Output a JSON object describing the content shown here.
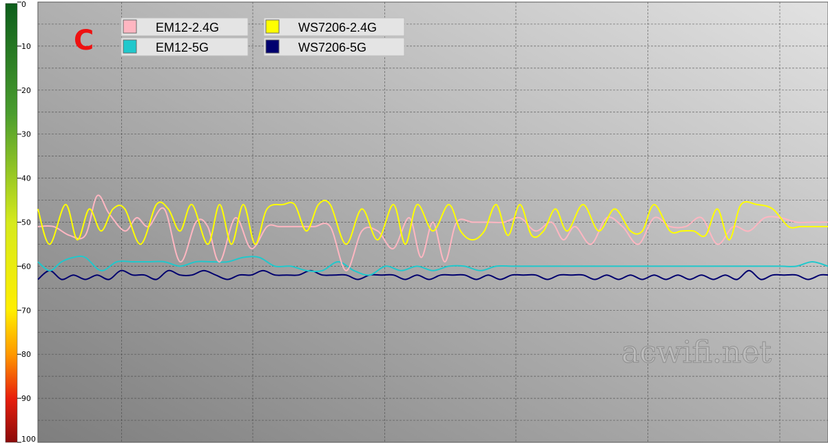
{
  "corner_label": "C",
  "watermark": "acwifi.net",
  "chart_data": {
    "type": "line",
    "title": "",
    "xlabel": "",
    "ylabel": "",
    "ylim": [
      0,
      100
    ],
    "y_inverted": true,
    "yticks": [
      "0",
      "10",
      "20",
      "30",
      "40",
      "50",
      "60",
      "70",
      "80",
      "90",
      "100"
    ],
    "grid": true,
    "legend_position": "top-left",
    "legend": [
      {
        "name": "EM12-2.4G",
        "color": "#ffb6c1"
      },
      {
        "name": "EM12-5G",
        "color": "#20c8cc"
      },
      {
        "name": "WS7206-2.4G",
        "color": "#ffff00"
      },
      {
        "name": "WS7206-5G",
        "color": "#00006e"
      }
    ],
    "series": [
      {
        "name": "EM12-2.4G",
        "color": "#ffb6c1",
        "x": [
          0,
          2,
          4,
          6,
          7.5,
          9,
          11,
          12.5,
          14,
          16,
          18,
          20,
          21.5,
          23,
          25,
          27,
          29,
          30.5,
          32,
          33.5,
          35,
          37,
          39,
          41,
          43,
          45,
          47,
          48.5,
          50,
          51.5,
          53,
          55,
          57,
          59,
          61,
          63,
          65,
          66.5,
          68,
          70,
          72,
          74,
          76,
          78,
          80,
          82,
          84,
          86,
          88,
          90,
          92,
          94,
          96,
          98,
          100
        ],
        "values": [
          51,
          51,
          53,
          53,
          44,
          48,
          52,
          49,
          51,
          47,
          59,
          50,
          51,
          59,
          49,
          56,
          51,
          51,
          51,
          51,
          51,
          51,
          61,
          52,
          52,
          56,
          49,
          58,
          50,
          59,
          50,
          50,
          50,
          50,
          49,
          52,
          50,
          54,
          51,
          55,
          49,
          51,
          55,
          49,
          51,
          51,
          49,
          55,
          51,
          52,
          49,
          49,
          50,
          50,
          50
        ]
      },
      {
        "name": "EM12-5G",
        "color": "#20c8cc",
        "x": [
          0,
          1.5,
          3,
          4.5,
          6,
          8,
          10,
          12,
          14,
          16,
          18,
          20,
          22,
          24,
          26,
          28,
          30,
          32,
          34,
          36,
          38,
          40,
          42,
          44,
          46,
          48,
          50,
          52,
          54,
          56,
          58,
          60,
          62,
          64,
          66,
          68,
          70,
          72,
          74,
          76,
          78,
          80,
          82,
          84,
          86,
          88,
          90,
          92,
          94,
          96,
          98,
          100
        ],
        "values": [
          59,
          61,
          59,
          58,
          58,
          61,
          59,
          59,
          59,
          59,
          60,
          59,
          59,
          59,
          58,
          58,
          60,
          60,
          61,
          61,
          59,
          61,
          62,
          60,
          61,
          60,
          61,
          60,
          60,
          61,
          60,
          60,
          60,
          60,
          60,
          60,
          60,
          60,
          60,
          60,
          60,
          60,
          60,
          60,
          60,
          60,
          60,
          60,
          60,
          60,
          59,
          60
        ]
      },
      {
        "name": "WS7206-2.4G",
        "color": "#ffff00",
        "x": [
          0,
          1.5,
          3.5,
          5,
          6.5,
          8,
          9.5,
          11,
          13,
          15,
          16.5,
          18,
          19.5,
          21.5,
          23,
          24.5,
          26,
          27.5,
          29,
          31,
          32.5,
          34,
          35.5,
          37,
          39,
          41,
          43,
          45,
          46.5,
          48,
          50,
          52,
          53.5,
          55,
          56.5,
          58,
          59.5,
          61,
          62.5,
          64,
          65.5,
          67,
          69,
          71,
          73,
          75,
          76.5,
          78,
          80,
          81.5,
          83,
          84.5,
          86,
          87.5,
          89,
          91,
          93,
          95,
          96.5,
          98,
          100
        ],
        "values": [
          47,
          55,
          46,
          54,
          47,
          52,
          47,
          47,
          55,
          46,
          47,
          52,
          46,
          55,
          46,
          55,
          46,
          55,
          47,
          46,
          46,
          52,
          46,
          46,
          55,
          47,
          54,
          46,
          55,
          46,
          52,
          46,
          52,
          54,
          52,
          46,
          53,
          46,
          53,
          52,
          47,
          52,
          46,
          52,
          47,
          52,
          52,
          46,
          52,
          52,
          52,
          53,
          47,
          54,
          46,
          46,
          47,
          51,
          51,
          51,
          51
        ]
      },
      {
        "name": "WS7206-5G",
        "color": "#00006e",
        "x": [
          0,
          1.5,
          3,
          4.5,
          6,
          7.5,
          9,
          10.5,
          12,
          13.5,
          15,
          16.5,
          18,
          19.5,
          21,
          22.5,
          24,
          25.5,
          27,
          28.5,
          30,
          31.5,
          33,
          34.5,
          36,
          37.5,
          39,
          40.5,
          42,
          43.5,
          45,
          46.5,
          48,
          49.5,
          51,
          52.5,
          54,
          55.5,
          57,
          58.5,
          60,
          61.5,
          63,
          64.5,
          66,
          67.5,
          69,
          70.5,
          72,
          73.5,
          75,
          76.5,
          78,
          79.5,
          81,
          82.5,
          84,
          85.5,
          87,
          88.5,
          90,
          91.5,
          93,
          94.5,
          96,
          97.5,
          99,
          100
        ],
        "values": [
          63,
          61,
          63,
          62,
          63,
          62,
          63,
          61,
          62,
          62,
          63,
          61,
          62,
          62,
          61,
          62,
          63,
          62,
          62,
          61,
          62,
          62,
          62,
          61,
          62,
          62,
          62,
          63,
          62,
          62,
          62,
          63,
          62,
          63,
          62,
          62,
          62,
          63,
          62,
          63,
          62,
          62,
          62,
          63,
          62,
          62,
          62,
          63,
          62,
          63,
          62,
          63,
          62,
          63,
          62,
          63,
          62,
          63,
          62,
          63,
          61,
          63,
          62,
          62,
          62,
          63,
          62,
          62
        ]
      }
    ]
  }
}
